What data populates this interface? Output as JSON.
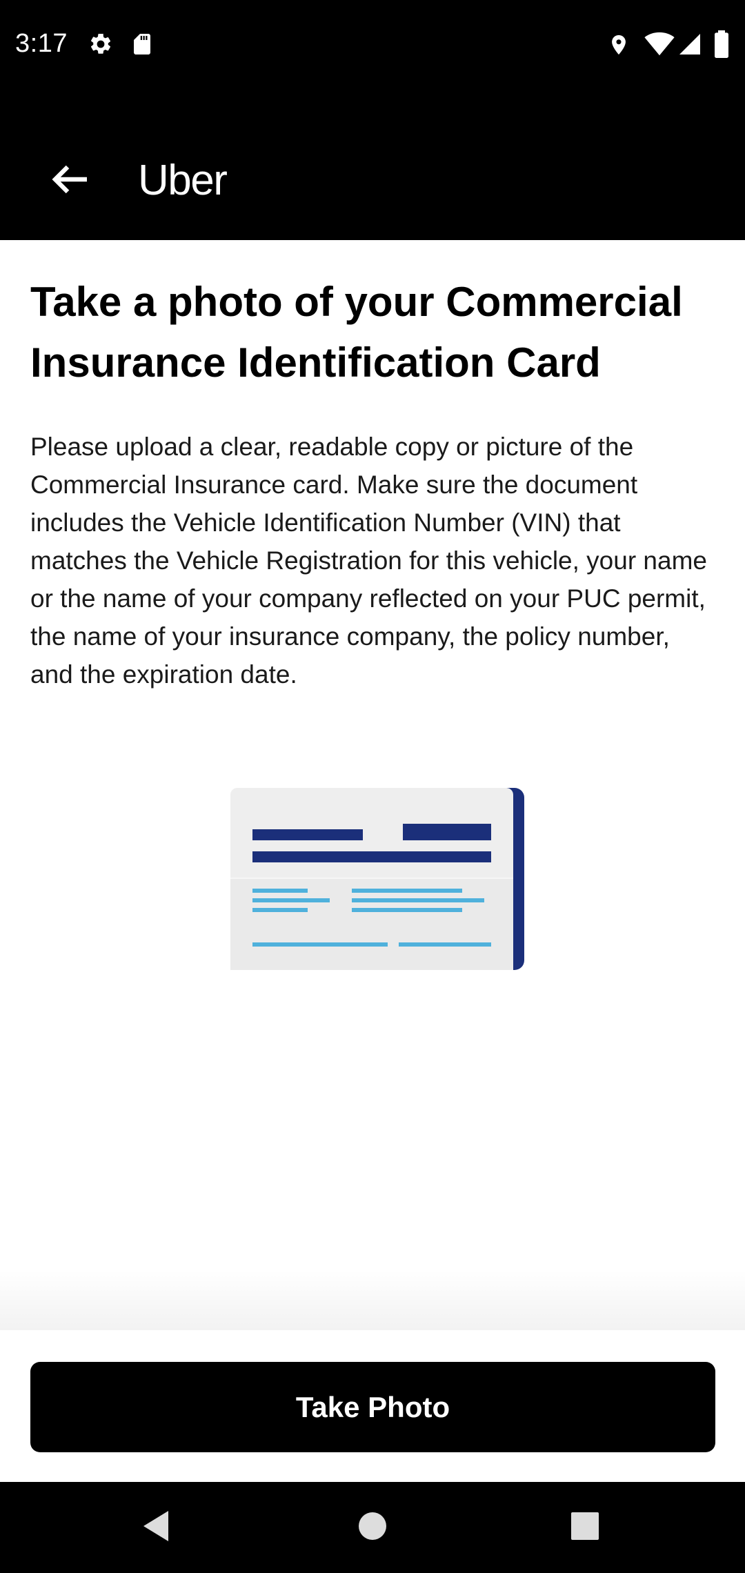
{
  "status_bar": {
    "time": "3:17",
    "left_icons": [
      "gear-icon",
      "sd-card-icon"
    ],
    "right_icons": [
      "location-icon",
      "wifi-icon",
      "signal-icon",
      "battery-icon"
    ]
  },
  "app_bar": {
    "back_icon": "arrow-left-icon",
    "title": "Uber"
  },
  "main": {
    "title": "Take a photo of your Commercial Insurance Identification Card",
    "description": "Please upload a clear, readable copy or picture of the Commercial Insurance card. Make sure the document includes the Vehicle Identification Number (VIN) that matches the Vehicle Registration for this vehicle, your name or the name of your company reflected on your PUC permit, the name of your insurance company, the policy number, and the expiration date.",
    "illustration": "insurance-card-illustration"
  },
  "actions": {
    "take_photo_label": "Take Photo"
  },
  "nav_bar": {
    "icons": [
      "back-triangle-icon",
      "home-circle-icon",
      "recents-square-icon"
    ]
  },
  "colors": {
    "card_dark_blue": "#1b2f7a",
    "card_light_blue": "#4fb1dc",
    "card_background": "#eeeeee",
    "bar_background": "#000000"
  }
}
